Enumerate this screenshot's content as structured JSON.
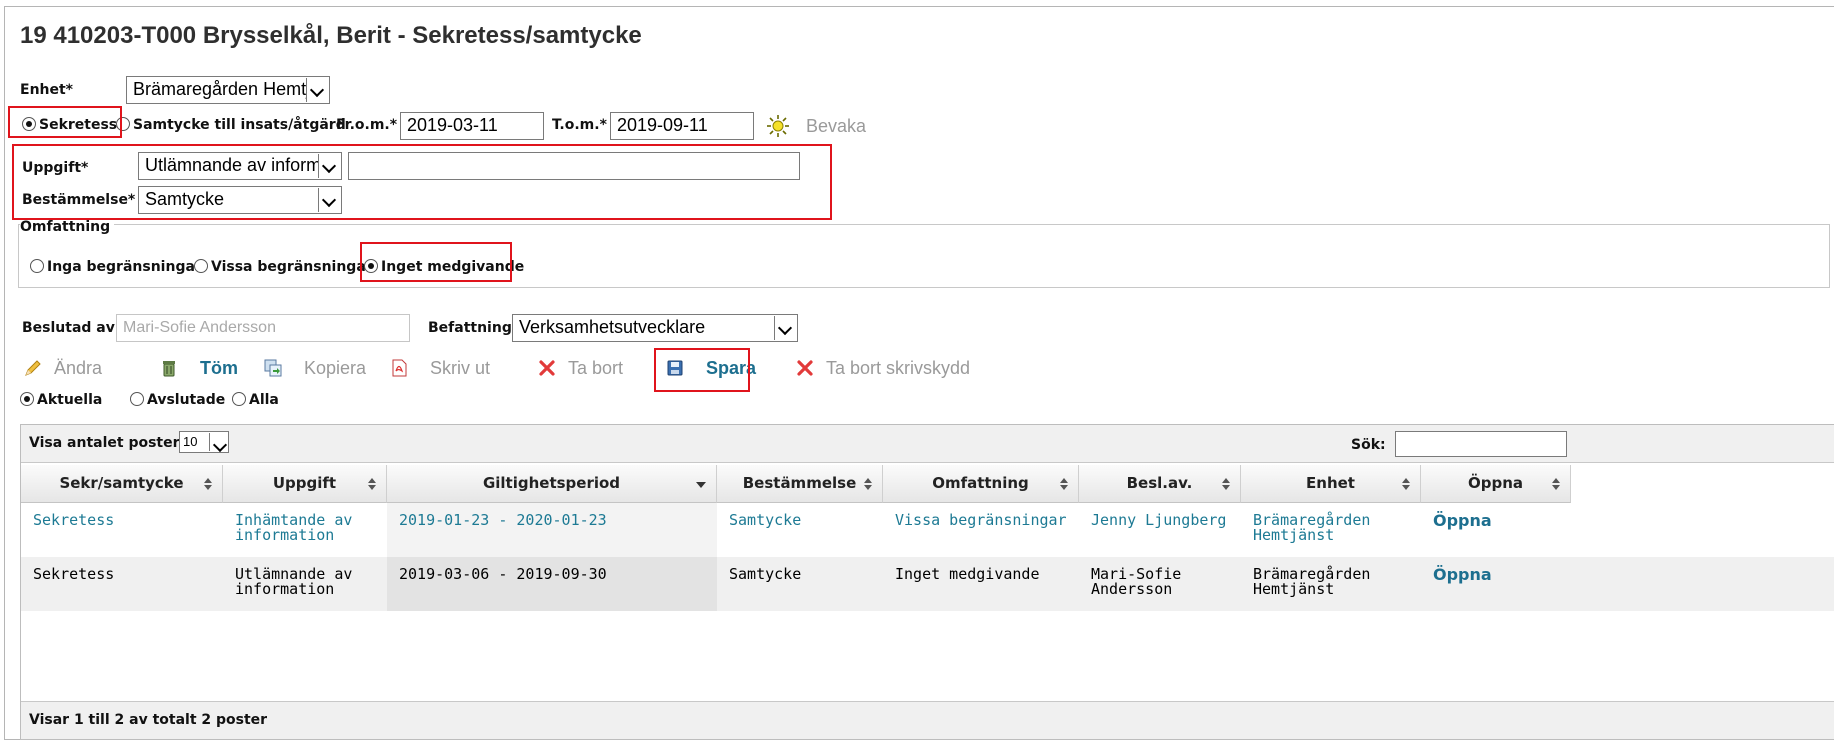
{
  "header": {
    "title": "19 410203-T000 Brysselkål, Berit - Sekretess/samtycke"
  },
  "form": {
    "enhet_label": "Enhet*",
    "enhet_value": "Brämaregården Hemtjär",
    "type_options": [
      {
        "label": "Sekretess",
        "selected": true
      },
      {
        "label": "Samtycke till insats/åtgärd",
        "selected": false
      }
    ],
    "from_label": "Fr.o.m.*",
    "from_value": "2019-03-11",
    "tom_label": "T.o.m.*",
    "tom_value": "2019-09-11",
    "bevaka_label": "Bevaka",
    "uppgift_label": "Uppgift*",
    "uppgift_value": "Utlämnande av informati",
    "uppgift_text": "",
    "bestammelse_label": "Bestämmelse*",
    "bestammelse_value": "Samtycke",
    "omfattning_legend": "Omfattning",
    "omfattning_options": [
      {
        "label": "Inga begränsningar",
        "selected": false
      },
      {
        "label": "Vissa begränsningar",
        "selected": false
      },
      {
        "label": "Inget medgivande",
        "selected": true
      }
    ],
    "beslutad_label": "Beslutad av",
    "beslutad_value": "Mari-Sofie Andersson",
    "befattning_label": "Befattning",
    "befattning_value": "Verksamhetsutvecklare"
  },
  "toolbar": {
    "andra": "Ändra",
    "tom": "Töm",
    "kopiera": "Kopiera",
    "skriv_ut": "Skriv ut",
    "ta_bort": "Ta bort",
    "spara": "Spara",
    "ta_bort_skrivskydd": "Ta bort skrivskydd"
  },
  "filter": [
    {
      "label": "Aktuella",
      "selected": true
    },
    {
      "label": "Avslutade",
      "selected": false
    },
    {
      "label": "Alla",
      "selected": false
    }
  ],
  "table": {
    "page_size_label": "Visa antalet poster",
    "page_size_value": "10",
    "search_label": "Sök:",
    "search_value": "",
    "columns": [
      "Sekr/samtycke",
      "Uppgift",
      "Giltighetsperiod",
      "Bestämmelse",
      "Omfattning",
      "Besl.av.",
      "Enhet",
      "Öppna"
    ],
    "rows": [
      {
        "typ": "Sekretess",
        "uppgift_1": "Inhämtande av",
        "uppgift_2": "information",
        "period": "2019-01-23 - 2020-01-23",
        "bestammelse": "Samtycke",
        "omfattning": "Vissa begränsningar",
        "besl_1": "Jenny Ljungberg",
        "besl_2": "",
        "enhet_1": "Brämaregården",
        "enhet_2": "Hemtjänst",
        "oppna": "Öppna"
      },
      {
        "typ": "Sekretess",
        "uppgift_1": "Utlämnande av",
        "uppgift_2": "information",
        "period": "2019-03-06 - 2019-09-30",
        "bestammelse": "Samtycke",
        "omfattning": "Inget medgivande",
        "besl_1": "Mari-Sofie",
        "besl_2": "Andersson",
        "enhet_1": "Brämaregården",
        "enhet_2": "Hemtjänst",
        "oppna": "Öppna"
      }
    ],
    "footer": "Visar 1 till 2 av totalt 2 poster"
  },
  "colors": {
    "link": "#1d7a94",
    "highlight": "#e0141c",
    "disabled": "#9a9a9a"
  }
}
